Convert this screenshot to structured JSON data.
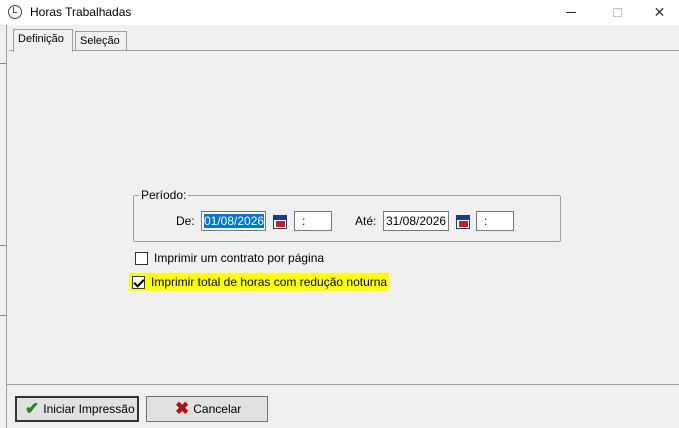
{
  "window": {
    "title": "Horas Trabalhadas",
    "minimize_glyph": "—",
    "maximize_glyph": "☐",
    "close_glyph": "✕"
  },
  "tabs": [
    {
      "label": "Definição",
      "active": true
    },
    {
      "label": "Seleção",
      "active": false
    }
  ],
  "periodo": {
    "group_label": "Período:",
    "de_label": "De:",
    "de_value": "01/08/2026",
    "de_time": ":",
    "ate_label": "Até:",
    "ate_value": "31/08/2026",
    "ate_time": ":"
  },
  "options": [
    {
      "label": "Imprimir um contrato por página",
      "checked": false
    },
    {
      "label": "Imprimir total de horas com redução noturna",
      "checked": true,
      "highlighted": true
    }
  ],
  "buttons": {
    "ok_label": "Iniciar Impressão",
    "cancel_label": "Cancelar"
  },
  "icons": {
    "app": "clock-icon",
    "calendar": "calendar-icon",
    "ok": "check-icon",
    "cancel": "x-icon"
  },
  "colors": {
    "selection": "#0078d7",
    "highlight": "#ffff00",
    "ok_icon": "#1a8a1a",
    "cancel_icon": "#b01010"
  }
}
